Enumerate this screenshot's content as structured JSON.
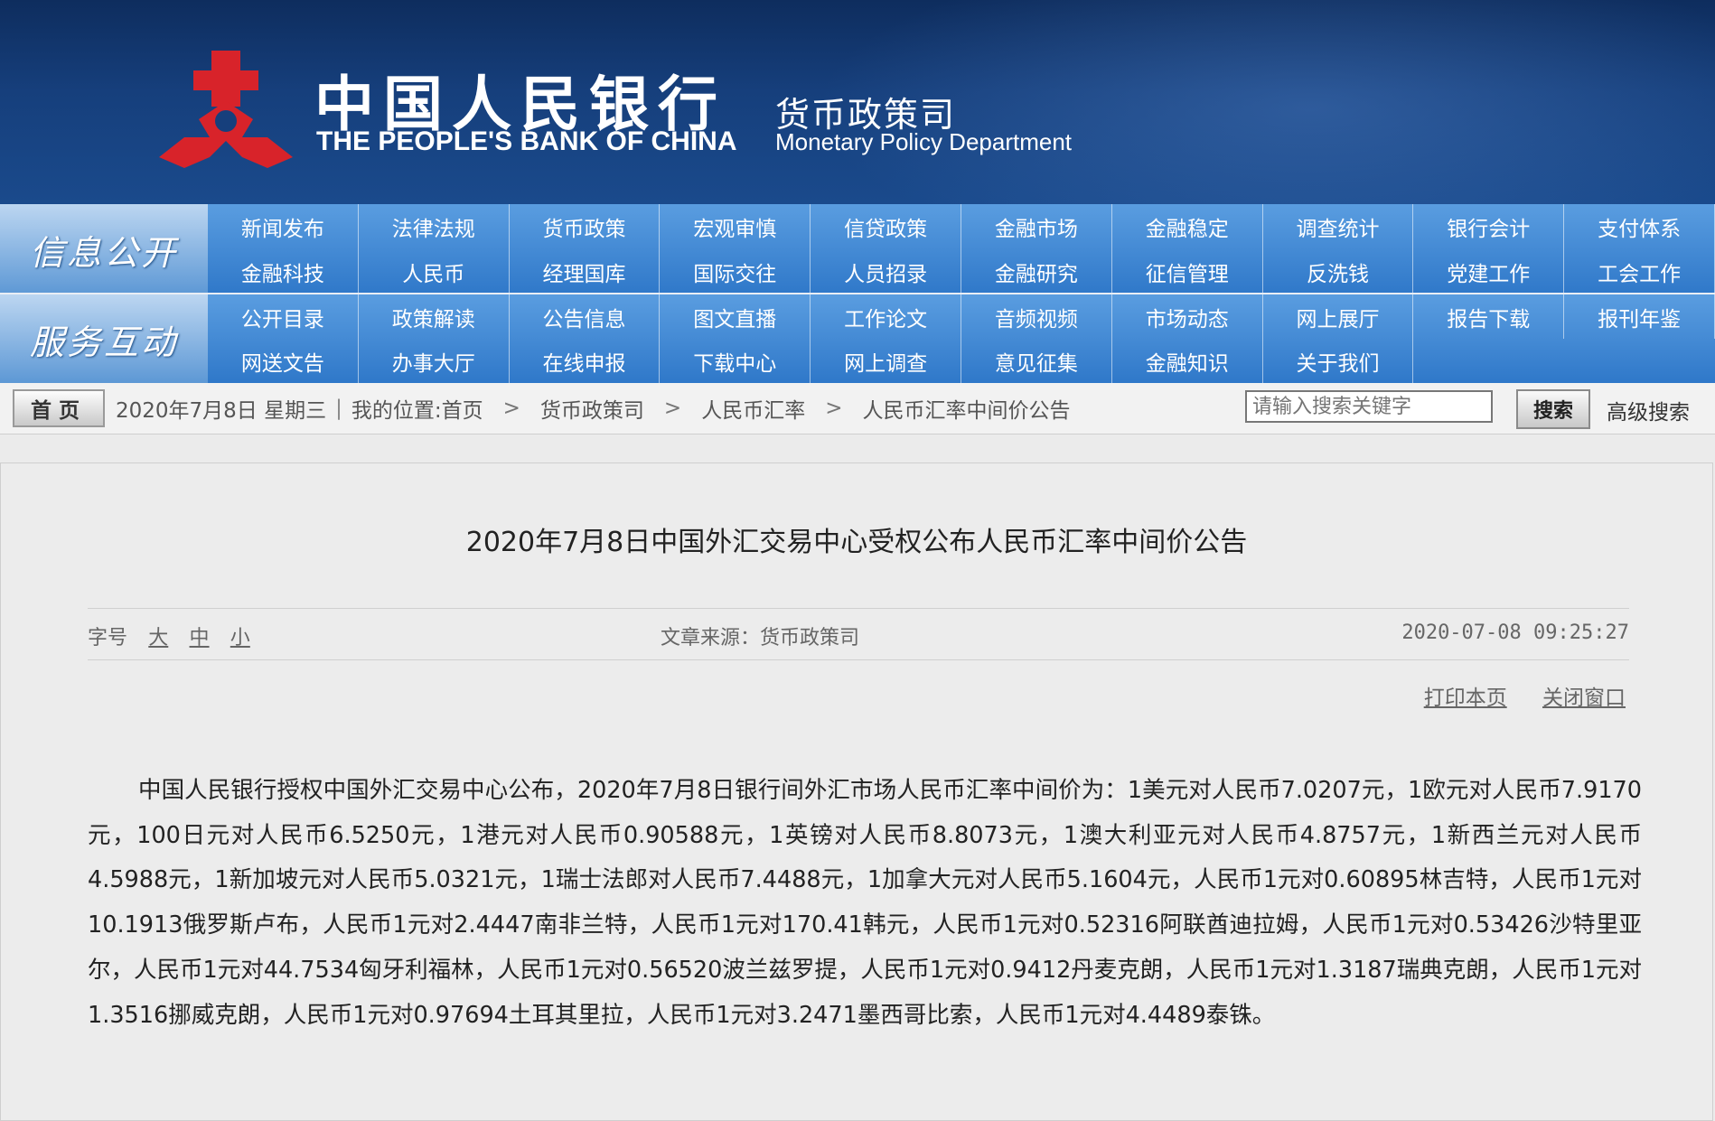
{
  "header": {
    "bank_cn": "中国人民银行",
    "bank_en": "THE PEOPLE'S BANK OF CHINA",
    "dept_cn": "货币政策司",
    "dept_en": "Monetary Policy Department",
    "logo_icon": "pboc-logo-icon"
  },
  "nav": {
    "info_label": "信息公开",
    "info_items": [
      "新闻发布",
      "法律法规",
      "货币政策",
      "宏观审慎",
      "信贷政策",
      "金融市场",
      "金融稳定",
      "调查统计",
      "银行会计",
      "支付体系",
      "金融科技",
      "人民币",
      "经理国库",
      "国际交往",
      "人员招录",
      "金融研究",
      "征信管理",
      "反洗钱",
      "党建工作",
      "工会工作"
    ],
    "service_label": "服务互动",
    "service_items": [
      "公开目录",
      "政策解读",
      "公告信息",
      "图文直播",
      "工作论文",
      "音频视频",
      "市场动态",
      "网上展厅",
      "报告下载",
      "报刊年鉴",
      "网送文告",
      "办事大厅",
      "在线申报",
      "下载中心",
      "网上调查",
      "意见征集",
      "金融知识",
      "关于我们",
      "",
      ""
    ]
  },
  "crumb": {
    "home": "首页",
    "date": "2020年7月8日 星期三",
    "sep": "|",
    "location_label": "我的位置:首页",
    "items": [
      "货币政策司",
      "人民币汇率",
      "人民币汇率中间价公告"
    ],
    "chevron": ">",
    "search_placeholder": "请输入搜索关键字",
    "search_button": "搜索",
    "advanced_search": "高级搜索"
  },
  "article": {
    "title": "2020年7月8日中国外汇交易中心受权公布人民币汇率中间价公告",
    "font_label": "字号",
    "font_large": "大",
    "font_medium": "中",
    "font_small": "小",
    "source": "文章来源：货币政策司",
    "time": "2020-07-08 09:25:27",
    "print": "打印本页",
    "close": "关闭窗口",
    "body": "中国人民银行授权中国外汇交易中心公布，2020年7月8日银行间外汇市场人民币汇率中间价为：1美元对人民币7.0207元，1欧元对人民币7.9170元，100日元对人民币6.5250元，1港元对人民币0.90588元，1英镑对人民币8.8073元，1澳大利亚元对人民币4.8757元，1新西兰元对人民币4.5988元，1新加坡元对人民币5.0321元，1瑞士法郎对人民币7.4488元，1加拿大元对人民币5.1604元，人民币1元对0.60895林吉特，人民币1元对10.1913俄罗斯卢布，人民币1元对2.4447南非兰特，人民币1元对170.41韩元，人民币1元对0.52316阿联酋迪拉姆，人民币1元对0.53426沙特里亚尔，人民币1元对44.7534匈牙利福林，人民币1元对0.56520波兰兹罗提，人民币1元对0.9412丹麦克朗，人民币1元对1.3187瑞典克朗，人民币1元对1.3516挪威克朗，人民币1元对0.97694土耳其里拉，人民币1元对3.2471墨西哥比索，人民币1元对4.4489泰铢。"
  },
  "colors": {
    "header_bg": "#163f7c",
    "nav_blue": "#2f78c9",
    "logo_red": "#d8232a"
  }
}
